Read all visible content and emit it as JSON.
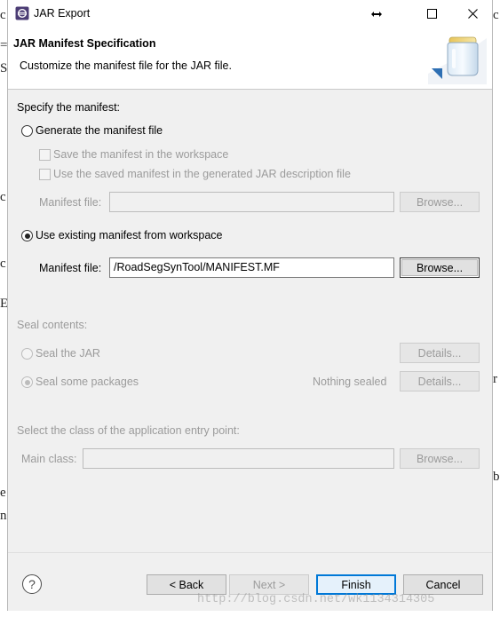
{
  "window": {
    "title": "JAR Export"
  },
  "header": {
    "title": "JAR Manifest Specification",
    "description": "Customize the manifest file for the JAR file."
  },
  "manifest": {
    "section_label": "Specify the manifest:",
    "generate": {
      "label": "Generate the manifest file",
      "selected": false,
      "save_in_workspace": "Save the manifest in the workspace",
      "use_saved_in_description": "Use the saved manifest in the generated JAR description file",
      "file_label": "Manifest file:",
      "file_value": "",
      "browse_label": "Browse..."
    },
    "existing": {
      "label": "Use existing manifest from workspace",
      "selected": true,
      "file_label": "Manifest file:",
      "file_value": "/RoadSegSynTool/MANIFEST.MF",
      "browse_label": "Browse..."
    }
  },
  "seal": {
    "section_label": "Seal contents:",
    "seal_jar": "Seal the JAR",
    "seal_jar_details": "Details...",
    "seal_packages": "Seal some packages",
    "seal_packages_status": "Nothing sealed",
    "seal_packages_details": "Details..."
  },
  "entry_point": {
    "section_label": "Select the class of the application entry point:",
    "main_class_label": "Main class:",
    "main_class_value": "",
    "browse_label": "Browse..."
  },
  "footer": {
    "back": "< Back",
    "next": "Next >",
    "finish": "Finish",
    "cancel": "Cancel"
  },
  "watermark": "http://blog.csdn.net/wk1134314305",
  "colors": {
    "dialog_bg": "#f0f0f0",
    "header_bg": "#ffffff",
    "disabled_text": "#9b9b9b",
    "primary_button_border": "#0078d7"
  },
  "icons": [
    "eclipse-app-icon",
    "resize-arrow-icon",
    "maximize-icon",
    "close-icon",
    "jar-wizard-icon",
    "help-icon"
  ]
}
